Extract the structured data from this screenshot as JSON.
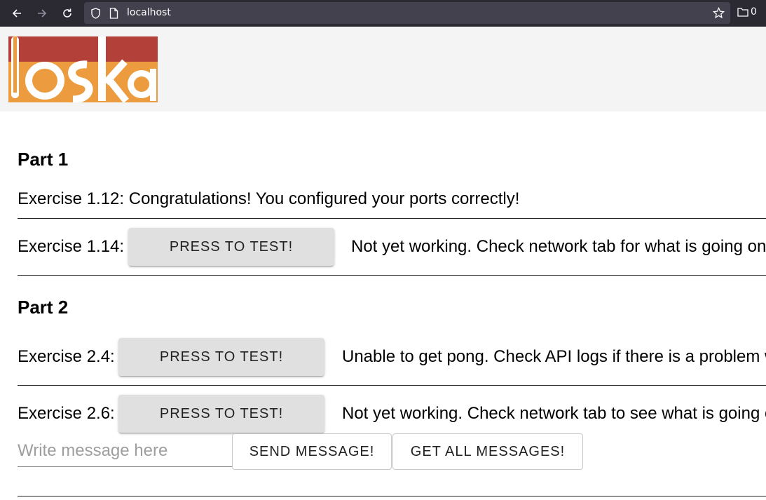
{
  "browser": {
    "url": "localhost",
    "folder_count": "0"
  },
  "part1": {
    "heading": "Part 1",
    "ex112_text": "Exercise 1.12: Congratulations! You configured your ports correctly!",
    "ex114_label": "Exercise 1.14:",
    "ex114_button": "PRESS TO TEST!",
    "ex114_status": "Not yet working. Check network tab for what is going on"
  },
  "part2": {
    "heading": "Part 2",
    "ex24_label": "Exercise 2.4:",
    "ex24_button": "PRESS TO TEST!",
    "ex24_status": "Unable to get pong. Check API logs if there is a problem with",
    "ex26_label": "Exercise 2.6:",
    "ex26_button": "PRESS TO TEST!",
    "ex26_status": "Not yet working. Check network tab to see what is going on",
    "message_placeholder": "Write message here",
    "send_button": "SEND MESSAGE!",
    "get_all_button": "GET ALL MESSAGES!"
  },
  "colors": {
    "logo_red": "#b3413a",
    "logo_orange": "#ec9c3e",
    "button_grey": "#e0e0e0"
  }
}
